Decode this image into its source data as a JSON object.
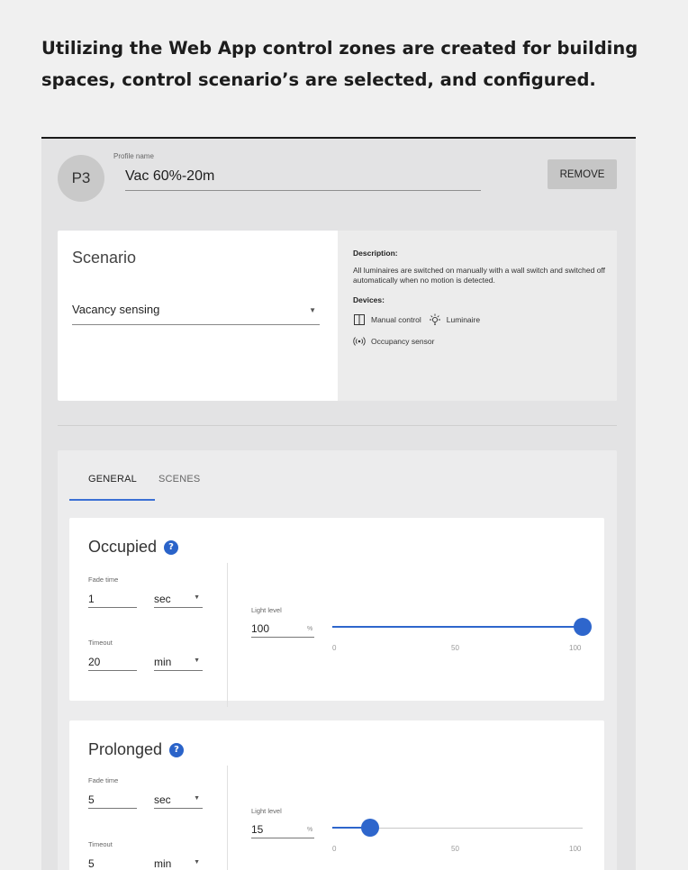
{
  "headline": "Utilizing the Web App control zones are created for building spaces, control scenario’s are selected, and configured.",
  "profile": {
    "avatar": "P3",
    "name_label": "Profile name",
    "name_value": "Vac 60%-20m",
    "remove_label": "REMOVE"
  },
  "scenario": {
    "title": "Scenario",
    "selected": "Vacancy sensing",
    "description_heading": "Description:",
    "description_text": "All luminaires are switched on manually with a wall switch and switched off automatically when no motion is detected.",
    "devices_heading": "Devices:",
    "devices": [
      {
        "label": "Manual control",
        "icon": "wall-switch-icon"
      },
      {
        "label": "Luminaire",
        "icon": "lightbulb-icon"
      },
      {
        "label": "Occupancy sensor",
        "icon": "occupancy-sensor-icon"
      }
    ]
  },
  "tabs": [
    {
      "label": "GENERAL",
      "active": true
    },
    {
      "label": "SCENES",
      "active": false
    }
  ],
  "modes": [
    {
      "title": "Occupied",
      "fade_label": "Fade time",
      "fade_value": "1",
      "fade_unit": "sec",
      "timeout_label": "Timeout",
      "timeout_value": "20",
      "timeout_unit": "min",
      "light_label": "Light level",
      "light_value": "100",
      "light_unit": "%",
      "slider_level": 100,
      "ticks": [
        "0",
        "50",
        "100"
      ]
    },
    {
      "title": "Prolonged",
      "fade_label": "Fade time",
      "fade_value": "5",
      "fade_unit": "sec",
      "timeout_label": "Timeout",
      "timeout_value": "5",
      "timeout_unit": "min",
      "light_label": "Light level",
      "light_value": "15",
      "light_unit": "%",
      "slider_level": 15,
      "ticks": [
        "0",
        "50",
        "100"
      ]
    }
  ],
  "colors": {
    "accent": "#2e66cc",
    "panel_bg": "#e3e3e4",
    "card_bg": "#ffffff"
  }
}
